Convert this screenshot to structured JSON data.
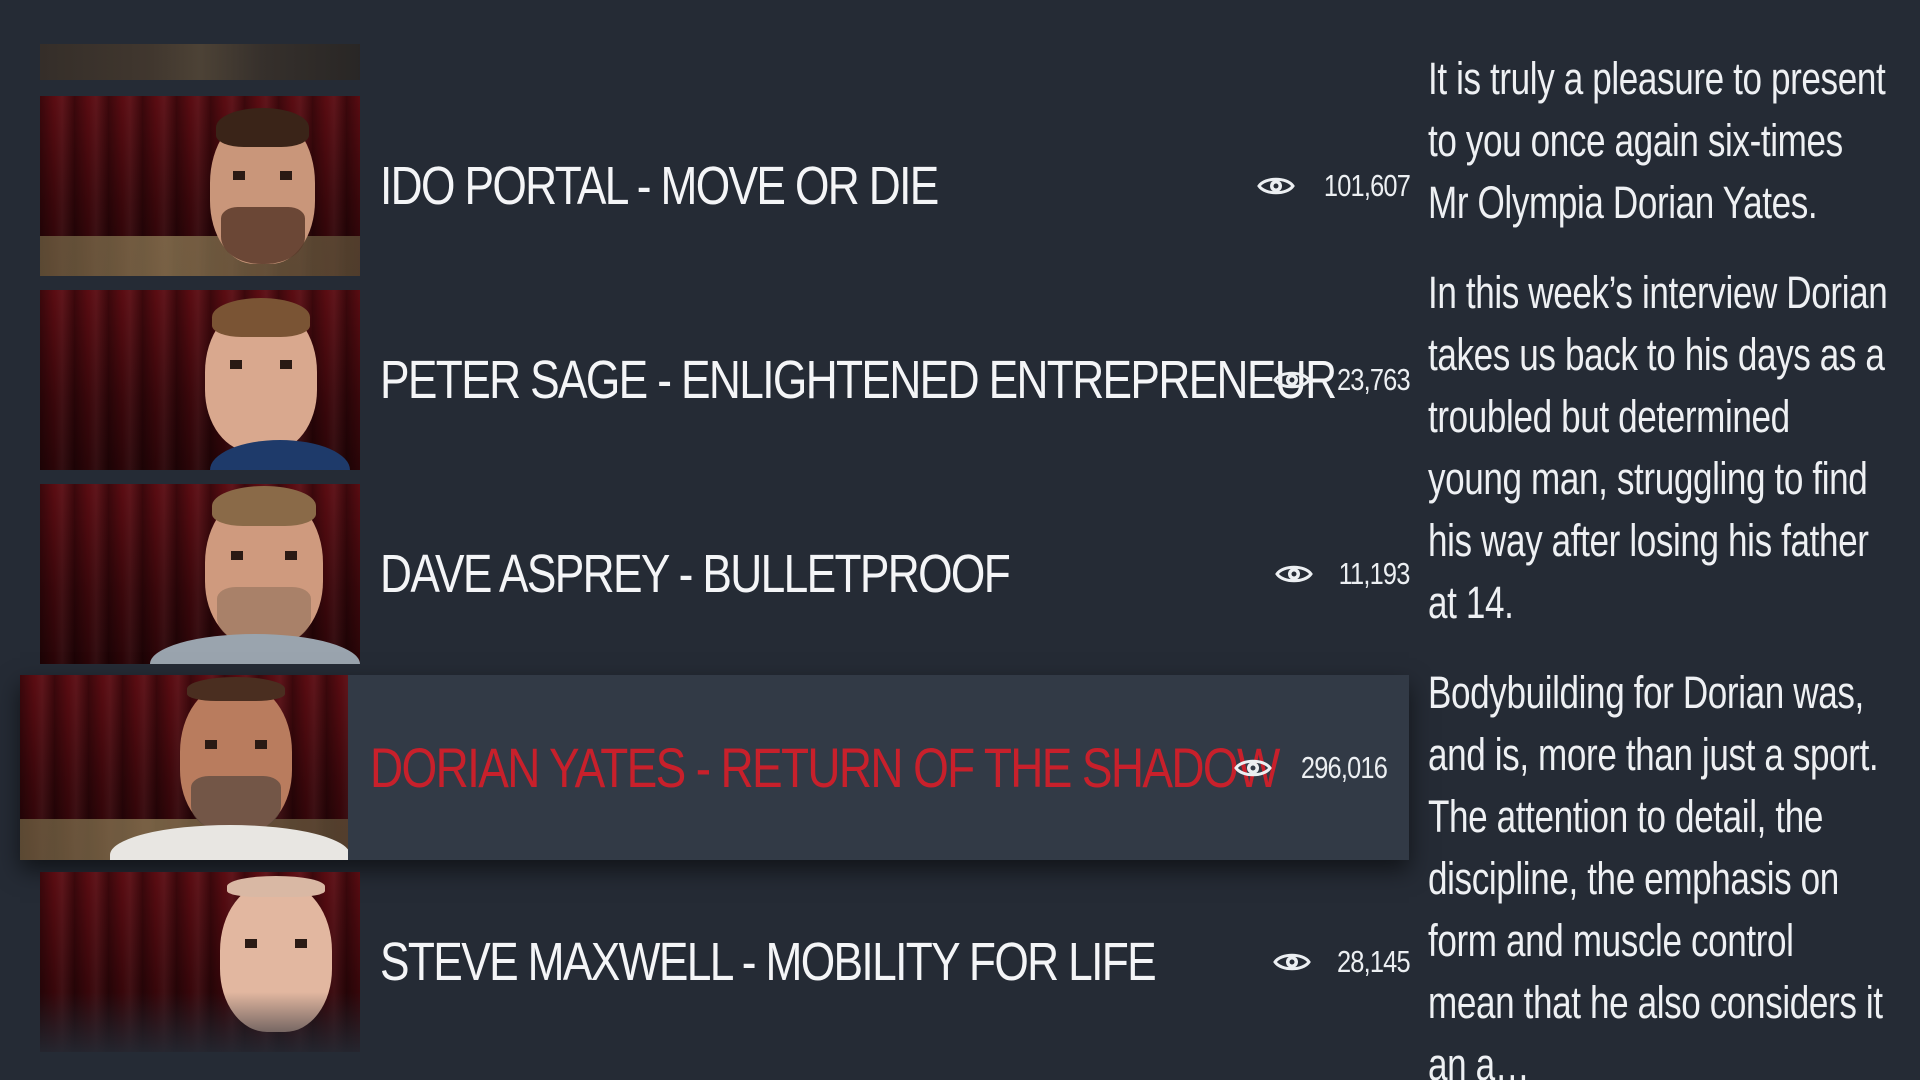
{
  "videos": [
    {
      "title": "IDO PORTAL - MOVE OR DIE",
      "views": "101,607",
      "thumb_icon": "ido-portal-thumbnail"
    },
    {
      "title": "PETER SAGE - ENLIGHTENED ENTREPRENEUR",
      "views": "23,763",
      "thumb_icon": "peter-sage-thumbnail"
    },
    {
      "title": "DAVE ASPREY - BULLETPROOF",
      "views": "11,193",
      "thumb_icon": "dave-asprey-thumbnail"
    },
    {
      "title": "DORIAN YATES - RETURN OF THE SHADOW",
      "views": "296,016",
      "thumb_icon": "dorian-yates-thumbnail",
      "selected": true
    },
    {
      "title": "STEVE MAXWELL - MOBILITY FOR LIFE",
      "views": "28,145",
      "thumb_icon": "steve-maxwell-thumbnail"
    }
  ],
  "description": {
    "paragraphs": [
      "It is truly a pleasure to present to you once again six-times Mr Olympia Dorian Yates.",
      "In this week’s interview Dorian takes us back to his days as a troubled but determined young man, struggling to find his way after losing his father at 14.",
      "Bodybuilding for Dorian was, and is, more than just a sport. The attention to detail, the discipline, the emphasis on form and muscle control mean that he also considers it an a…"
    ]
  },
  "colors": {
    "background": "#252b35",
    "selected_row": "#323a46",
    "selected_title": "#c8202b",
    "text": "#f4f5f7"
  }
}
